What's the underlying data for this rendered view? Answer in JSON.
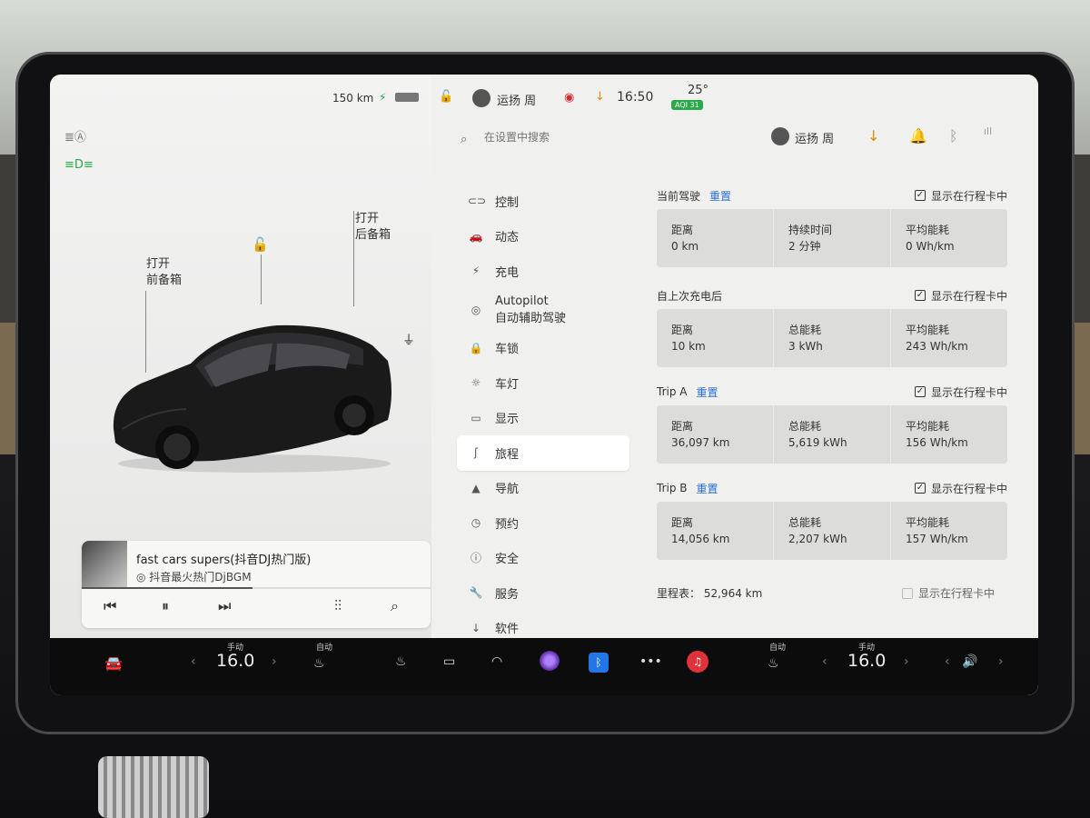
{
  "status": {
    "range": "150 km",
    "time": "16:50",
    "temperature": "25°",
    "aqi": "AQI 31",
    "user": "运扬 周"
  },
  "search": {
    "placeholder": "在设置中搜索"
  },
  "header_user": "运扬 周",
  "car_view": {
    "frunk_l1": "打开",
    "frunk_l2": "前备箱",
    "trunk_l1": "打开",
    "trunk_l2": "后备箱"
  },
  "music": {
    "song": "fast cars supers(抖音DJ热门版)",
    "artist": "抖音最火热门DjBGM",
    "progress": 0.49
  },
  "menu": [
    {
      "icon": "toggle-icon",
      "glyph": "⊂⊃",
      "label": "控制",
      "label2": ""
    },
    {
      "icon": "car-icon",
      "glyph": "🚗",
      "label": "动态",
      "label2": ""
    },
    {
      "icon": "bolt-icon",
      "glyph": "⚡",
      "label": "充电",
      "label2": ""
    },
    {
      "icon": "steering-wheel-icon",
      "glyph": "◎",
      "label": "Autopilot",
      "label2": "自动辅助驾驶"
    },
    {
      "icon": "lock-icon",
      "glyph": "🔒",
      "label": "车锁",
      "label2": ""
    },
    {
      "icon": "light-icon",
      "glyph": "☼",
      "label": "车灯",
      "label2": ""
    },
    {
      "icon": "display-icon",
      "glyph": "▭",
      "label": "显示",
      "label2": ""
    },
    {
      "icon": "trip-icon",
      "glyph": "ʃ",
      "label": "旅程",
      "label2": ""
    },
    {
      "icon": "navigate-icon",
      "glyph": "▲",
      "label": "导航",
      "label2": ""
    },
    {
      "icon": "schedule-icon",
      "glyph": "◷",
      "label": "预约",
      "label2": ""
    },
    {
      "icon": "safety-icon",
      "glyph": "ⓘ",
      "label": "安全",
      "label2": ""
    },
    {
      "icon": "wrench-icon",
      "glyph": "🔧",
      "label": "服务",
      "label2": ""
    },
    {
      "icon": "download-icon",
      "glyph": "↓",
      "label": "软件",
      "label2": ""
    }
  ],
  "show_on_card": "显示在行程卡中",
  "reset": "重置",
  "sections": [
    {
      "title": "当前驾驶",
      "reset": true,
      "checked": true,
      "stats": [
        {
          "label": "距离",
          "value": "0 km"
        },
        {
          "label": "持续时间",
          "value": "2 分钟"
        },
        {
          "label": "平均能耗",
          "value": "0 Wh/km"
        }
      ]
    },
    {
      "title": "自上次充电后",
      "reset": false,
      "checked": true,
      "stats": [
        {
          "label": "距离",
          "value": "10 km"
        },
        {
          "label": "总能耗",
          "value": "3 kWh"
        },
        {
          "label": "平均能耗",
          "value": "243 Wh/km"
        }
      ]
    },
    {
      "title": "Trip A",
      "reset": true,
      "checked": true,
      "stats": [
        {
          "label": "距离",
          "value": "36,097 km"
        },
        {
          "label": "总能耗",
          "value": "5,619 kWh"
        },
        {
          "label": "平均能耗",
          "value": "156 Wh/km"
        }
      ]
    },
    {
      "title": "Trip B",
      "reset": true,
      "checked": true,
      "stats": [
        {
          "label": "距离",
          "value": "14,056 km"
        },
        {
          "label": "总能耗",
          "value": "2,207 kWh"
        },
        {
          "label": "平均能耗",
          "value": "157 Wh/km"
        }
      ]
    }
  ],
  "odometer": {
    "label": "里程表：",
    "value": "52,964 km"
  },
  "dock": {
    "left_temp_mode": "手动",
    "left_temp": "16.0",
    "left_seat_mode": "自动",
    "right_seat_mode": "自动",
    "right_temp_mode": "手动",
    "right_temp": "16.0"
  }
}
